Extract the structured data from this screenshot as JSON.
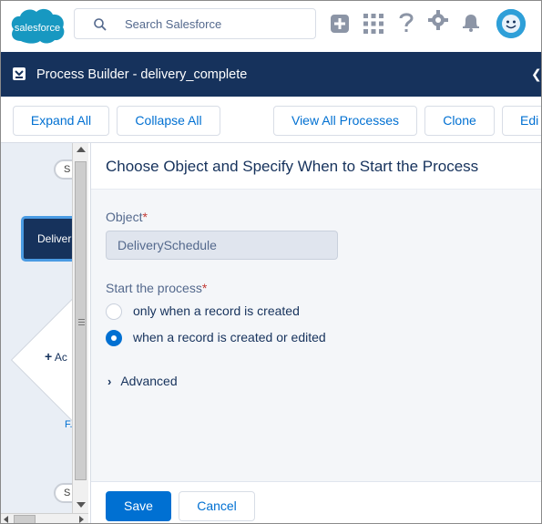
{
  "header": {
    "logo_text": "salesforce",
    "search_placeholder": "Search Salesforce",
    "icons": [
      "add-icon",
      "app-launcher-icon",
      "help-icon",
      "setup-gear-icon",
      "notifications-bell-icon",
      "avatar"
    ],
    "brand_color": "#1798c1"
  },
  "app_bar": {
    "title": "Process Builder - delivery_complete",
    "background": "#16325c"
  },
  "toolbar": {
    "expand_all": "Expand All",
    "collapse_all": "Collapse All",
    "view_all_processes": "View All Processes",
    "clone": "Clone",
    "edit": "Edi"
  },
  "canvas": {
    "start_pill": "S",
    "criteria_node": "Deliver",
    "add_action": "Ac",
    "node_caption": "F.",
    "end_pill": "S"
  },
  "panel": {
    "title": "Choose Object and Specify When to Start the Process",
    "object_label": "Object",
    "required_mark": "*",
    "object_value": "DeliverySchedule",
    "start_label": "Start the process",
    "options": [
      {
        "label": "only when a record is created",
        "checked": false
      },
      {
        "label": "when a record is created or edited",
        "checked": true
      }
    ],
    "advanced_label": "Advanced",
    "save": "Save",
    "cancel": "Cancel"
  }
}
